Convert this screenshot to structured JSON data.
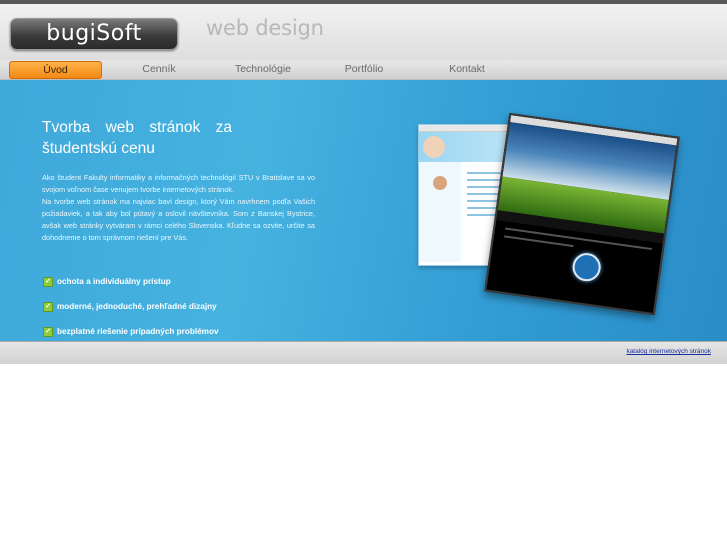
{
  "header": {
    "logo_text": "bugiSoft",
    "tagline": "web design"
  },
  "nav": {
    "items": [
      {
        "label": "Úvod",
        "active": true
      },
      {
        "label": "Cenník",
        "active": false
      },
      {
        "label": "Technológie",
        "active": false
      },
      {
        "label": "Portfólio",
        "active": false
      },
      {
        "label": "Kontakt",
        "active": false
      }
    ]
  },
  "main": {
    "title_line1": "Tvorba web stránok za",
    "title_line2": "študentskú cenu",
    "paragraph1": "Ako študent Fakulty informatiky a informačných technológií STU v Bratislave sa vo svojom voľnom čase venujem tvorbe internetových stránok.",
    "paragraph2": "Na tvorbe web stránok ma najviac baví design, ktorý Vám navrhnem podľa Vašich požiadaviek, a tak aby bol pútavý a oslovil návštevníka. Som z Banskej Bystrice, avšak web stránky vytváram v rámci celého Slovenska. Kľudne sa ozvite, určite sa dohodneme o tom správnom riešení pre Vás.",
    "features": [
      "ochota a individuálny prístup",
      "moderné, jednoduché, prehľadné dizajny",
      "bezplatné riešenie prípadných problémov"
    ]
  },
  "footer": {
    "link_text": "katalóg internetových stránok"
  },
  "colors": {
    "accent": "#f38a14",
    "main_bg": "#3ea9da",
    "check": "#8fce3a"
  }
}
